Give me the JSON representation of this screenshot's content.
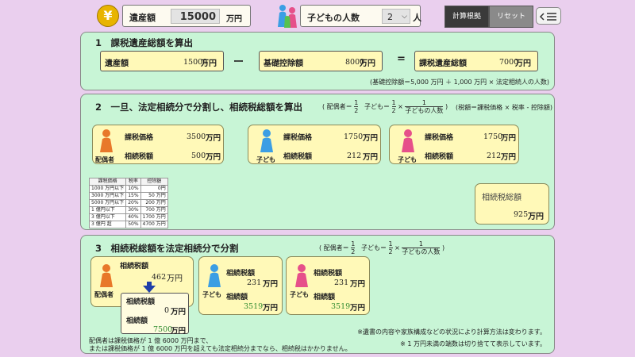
{
  "header": {
    "coin_symbol": "¥",
    "estate_label": "遺産額",
    "estate_value": "15000",
    "estate_unit": "万円",
    "children_label": "子どもの人数",
    "children_value": "2",
    "children_unit": "人",
    "calc_basis_label": "計算根拠",
    "reset_label": "リセット"
  },
  "section1": {
    "title": "1　課税遺産総額を算出",
    "estate_label": "遺産額",
    "estate_value": "15000",
    "estate_unit": "万円",
    "minus": "ー",
    "deduction_label": "基礎控除額",
    "deduction_value": "8000",
    "deduction_unit": "万円",
    "equals": "=",
    "taxable_label": "課税遺産総額",
    "taxable_value": "7000",
    "taxable_unit": "万円",
    "note": "(基礎控除額＝5,000 万円 ＋ 1,000 万円 × 法定相続人の人数)"
  },
  "section2": {
    "title": "2　一旦、法定相続分で分割し、相続税総額を算出",
    "ratio_open": "(",
    "spouse_ratio_label": "配偶者＝",
    "ratio_one": "1",
    "ratio_two": "2",
    "child_ratio_label": "子ども＝",
    "times": "×",
    "child_denominator": "子どもの人数",
    "ratio_close": ")",
    "formula": "(税額＝課税価格 × 税率 - 控除額)",
    "spouse": {
      "role": "配偶者",
      "taxable_label": "課税価格",
      "taxable_value": "3500",
      "tax_label": "相続税額",
      "tax_value": "500",
      "unit": "万円"
    },
    "child1": {
      "role": "子ども",
      "taxable_label": "課税価格",
      "taxable_value": "1750",
      "tax_label": "相続税額",
      "tax_value": "212",
      "unit": "万円"
    },
    "child2": {
      "role": "子ども",
      "taxable_label": "課税価格",
      "taxable_value": "1750",
      "tax_label": "相続税額",
      "tax_value": "212",
      "unit": "万円"
    },
    "rate_table": {
      "headers": [
        "課税価格",
        "税率",
        "控除額"
      ],
      "rows": [
        [
          "1000 万円以下",
          "10%",
          "0円"
        ],
        [
          "3000 万円以下",
          "15%",
          "50 万円"
        ],
        [
          "5000 万円以下",
          "20%",
          "200 万円"
        ],
        [
          "1 億円以下",
          "30%",
          "700 万円"
        ],
        [
          "3 億円以下",
          "40%",
          "1700 万円"
        ],
        [
          "3 億円 超",
          "50%",
          "4700 万円"
        ]
      ]
    },
    "total": {
      "label": "相続税総額",
      "value": "925",
      "unit": "万円"
    }
  },
  "section3": {
    "title": "3　相続税総額を法定相続分で分割",
    "spouse": {
      "role": "配偶者",
      "tax_label": "相続税額",
      "tax_value": "462",
      "tax_unit": "万円",
      "final_tax_label": "相続税額",
      "final_tax_value": "0",
      "inherit_label": "相続額",
      "inherit_value": "7500",
      "unit": "万円"
    },
    "child1": {
      "role": "子ども",
      "tax_label": "相続税額",
      "tax_value": "231",
      "inherit_label": "相続額",
      "inherit_value": "3519",
      "unit": "万円"
    },
    "child2": {
      "role": "子ども",
      "tax_label": "相続税額",
      "tax_value": "231",
      "inherit_label": "相続額",
      "inherit_value": "3519",
      "unit": "万円"
    },
    "note_spouse_1": "配偶者は課税価格が 1 億 6000 万円まで、",
    "note_spouse_2": "または課税価格が 1 億 6000 万円を超えても法定相続分までなら、相続税はかかりません。",
    "note_right_1": "※遺書の内容や家族構成などの状況により計算方法は変わります。",
    "note_right_2": "※ 1 万円未満の端数は切り捨てて表示しています。"
  },
  "colors": {
    "page_bg": "#eacfee",
    "panel_bg": "#c8f5d6",
    "card_bg": "#fff9b8",
    "spouse_figure": "#e8782a",
    "child1_figure": "#3b9ee4",
    "child2_figure": "#e6508a",
    "accent_green": "#2f8a2f",
    "arrow_blue": "#1e3ea8"
  }
}
